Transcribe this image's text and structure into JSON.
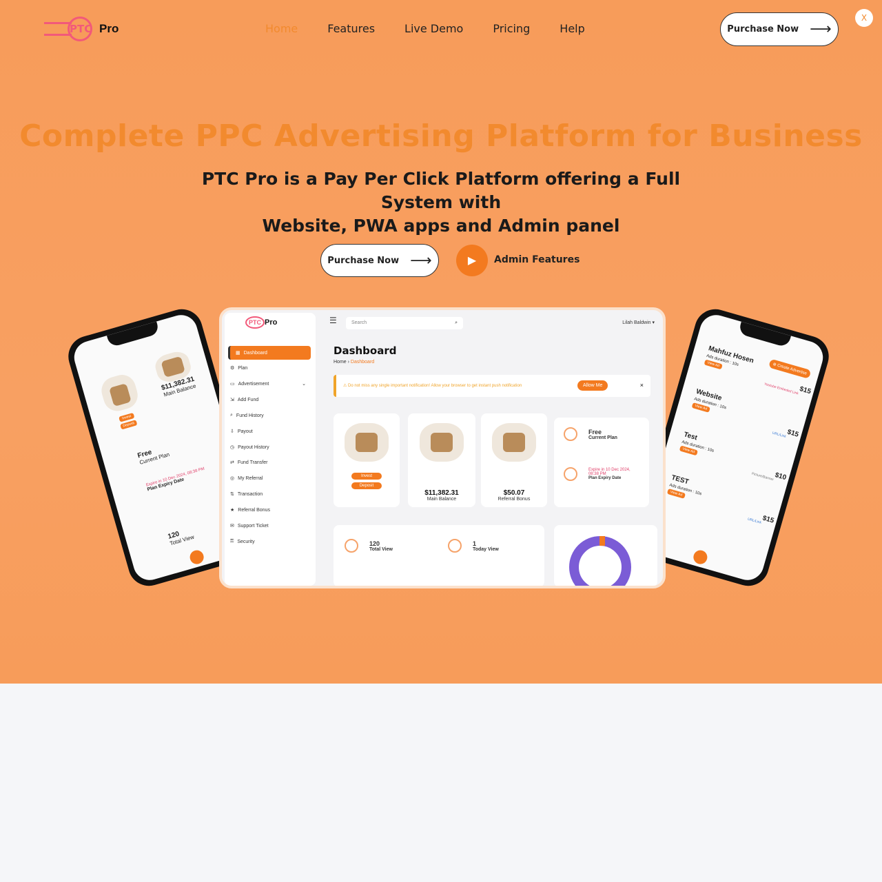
{
  "brand": {
    "logo_ring": "PTC",
    "logo_text": "Pro"
  },
  "nav": {
    "items": [
      {
        "label": "Home",
        "active": true
      },
      {
        "label": "Features"
      },
      {
        "label": "Live Demo"
      },
      {
        "label": "Pricing"
      },
      {
        "label": "Help"
      }
    ],
    "purchase": "Purchase Now",
    "close": "X"
  },
  "hero": {
    "title": "Complete PPC Advertising Platform for Business",
    "subtitle_line1": "PTC Pro is a Pay Per Click Platform offering a Full System with",
    "subtitle_line2": "Website, PWA apps and Admin panel",
    "purchase": "Purchase Now",
    "admin": "Admin Features"
  },
  "colors": {
    "accent": "#f37a1f",
    "hero_bg": "#f79c5a",
    "title": "#f28a2e",
    "donut": "#7b5cd6"
  },
  "dashboard": {
    "sidebar": [
      "Dashboard",
      "Plan",
      "Advertisement",
      "Add Fund",
      "Fund History",
      "Payout",
      "Payout History",
      "Fund Transfer",
      "My Referral",
      "Transaction",
      "Referral Bonus",
      "Support Ticket",
      "Security"
    ],
    "search_placeholder": "Search",
    "user": "Lilah Baldwin ▾",
    "title": "Dashboard",
    "crumb_home": "Home",
    "crumb_current": "Dashboard",
    "alert": "Do not miss any single important notification! Allow your browser to get instant push notification",
    "allow": "Allow Me",
    "alert_close": "×",
    "invest": "Invest",
    "deposit": "Deposit",
    "balance": "$11,382.31",
    "balance_label": "Main Balance",
    "referral": "$50.07",
    "referral_label": "Referral Bonus",
    "plan": "Free",
    "plan_label": "Current Plan",
    "expiry": "Expire in 10 Dec 2024, 08:38 PM",
    "expiry_label": "Plan Expiry Date",
    "total_view": "120",
    "total_view_label": "Total View",
    "today_view": "1",
    "today_view_label": "Today View"
  },
  "phone_right": {
    "create": "⊕ Create Advertise",
    "ads": [
      {
        "title": "Mahfuz Hosen",
        "duration": "Ads duration : 10s",
        "price": "$15",
        "type": "Youtube Embeded Link"
      },
      {
        "title": "Website",
        "duration": "Ads duration : 10s",
        "price": "$15",
        "type": "URL/Link"
      },
      {
        "title": "Test",
        "duration": "Ads duration : 10s",
        "price": "$10",
        "type": "Picture/Banner"
      },
      {
        "title": "TEST",
        "duration": "Ads duration : 10s",
        "price": "$15",
        "type": "URL/Link"
      }
    ],
    "view_ad": "View Ad"
  }
}
